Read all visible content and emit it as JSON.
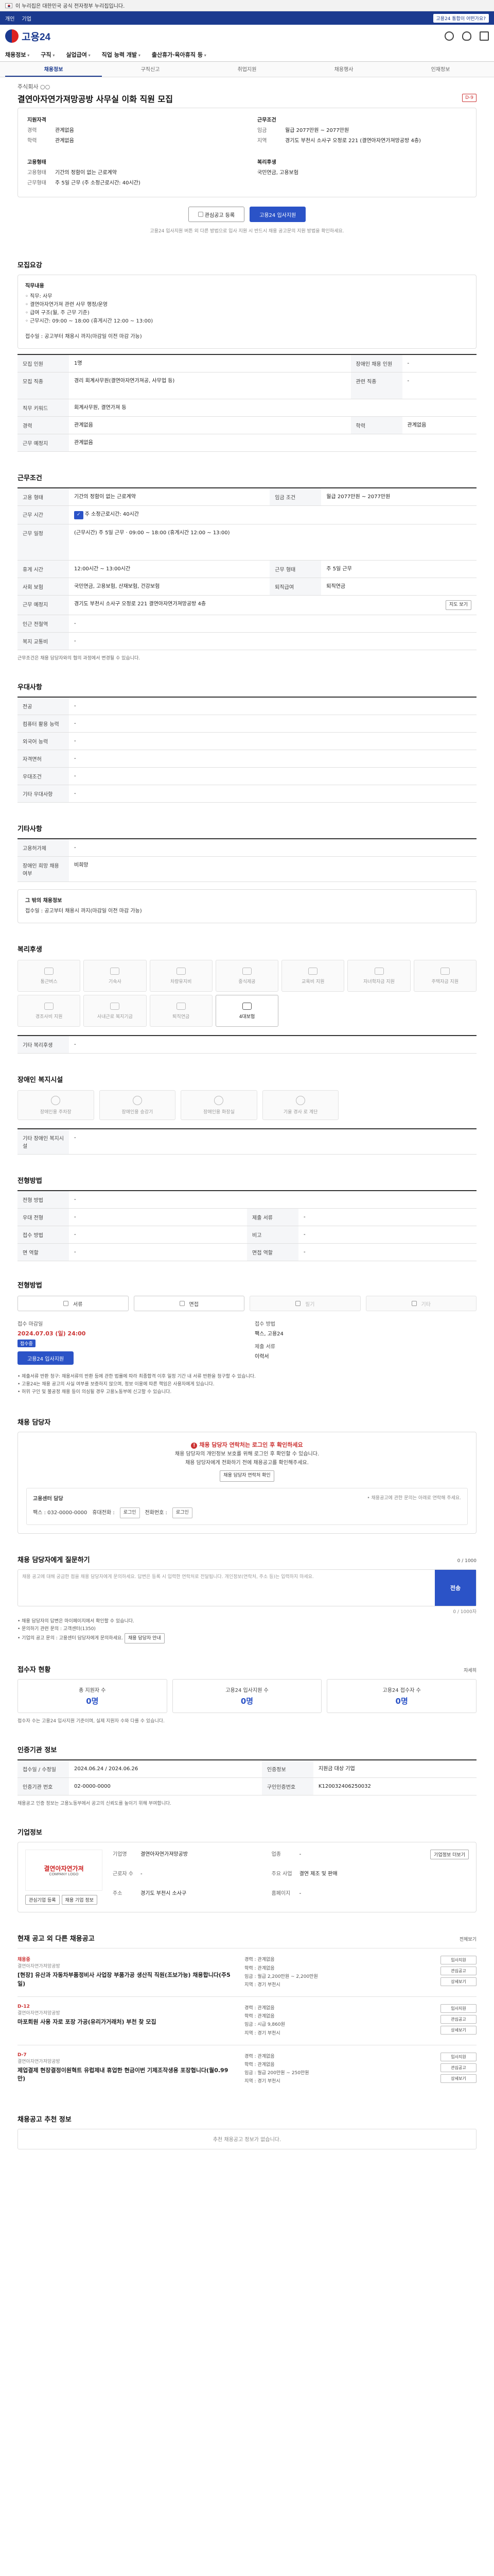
{
  "gov_banner": {
    "text": "이 누리집은 대한민국 공식 전자정부 누리집입니다."
  },
  "utilbar": {
    "left": [
      "개인",
      "기업"
    ],
    "right_badge": "고용24 통합이 어떤가요?"
  },
  "logo": {
    "text": "고용24"
  },
  "gnb": [
    "채용정보",
    "구직",
    "실업급여",
    "직업 능력 개발",
    "출산휴가·육아휴직 등"
  ],
  "subnav": [
    {
      "label": "채용정보",
      "active": true
    },
    {
      "label": "구직신고",
      "active": false
    },
    {
      "label": "취업지원",
      "active": false
    },
    {
      "label": "채용행사",
      "active": false
    },
    {
      "label": "인재정보",
      "active": false
    }
  ],
  "job": {
    "company": "주식회사 ○○",
    "title": "결연아자연가져망공방 사무실 이화 직원 모집",
    "dday": "D-9",
    "summary": {
      "qual_title": "지원자격",
      "qual": [
        {
          "k": "경력",
          "v": "관계없음"
        },
        {
          "k": "학력",
          "v": "관계없음"
        }
      ],
      "cond_title": "근무조건",
      "cond": [
        {
          "k": "임금",
          "v": "월급 2077만원 ~ 2077만원"
        },
        {
          "k": "지역",
          "v": "경기도 부천시 소사구 오정로 221 (결연아자연가져망공방 4층)"
        }
      ],
      "type_title": "고용형태",
      "type": [
        {
          "k": "고용형태",
          "v": "기간의 정함이 없는 근로계약"
        },
        {
          "k": "근무형태",
          "v": "주 5일 근무 (주 소정근로시간: 40시간)"
        }
      ],
      "welfare_title": "복리후생",
      "welfare": [
        {
          "k": "",
          "v": "국민연금, 고용보험"
        }
      ]
    },
    "buttons": {
      "scrap": "관심공고 등록",
      "apply": "고용24 입사지원"
    },
    "notice": "고용24 입사지원 버튼 외 다른 방법으로 입사 지원 시 반드시 채용 공고문의 지원 방법을 확인하세요."
  },
  "sections": {
    "recruit": "모집요강",
    "conditions": "근무조건",
    "prefer": "우대사항",
    "etc": "기타사항",
    "welfare": "복리후생",
    "barrier": "장애인 복지시설",
    "screen": "전형방법",
    "contact": "채용 담당자",
    "qna": "채용 담당자에게 질문하기",
    "status": "접수자 현황",
    "regist": "인증기관 정보",
    "company": "기업정보",
    "other_jobs": "현재 공고 외 다른 채용공고",
    "similar": "채용공고 추천 정보"
  },
  "recruit": {
    "job_label": "직무내용",
    "job_lines": [
      "◦ 직무: 사무",
      "◦ 결연아자연가져 관련 사무 행정/운영",
      "◦ 급여 구조(월, 주 근무 기준)",
      "◦ 근무시간: 09:00 ~ 18:00 (휴게시간 12:00 ~ 13:00)"
    ],
    "extra": "접수일 : 공고부터 채용시 까지(마감일 이전 마감 가능)",
    "rows": [
      {
        "k": "모집 인원",
        "v": "1명",
        "k2": "장애인 채용 인원",
        "v2": "-"
      },
      {
        "k": "모집 직종",
        "v": "경리 회계사무원(결연아자연가져공, 사무업 등)",
        "k2": "관련 직종",
        "v2": "-"
      },
      {
        "k": "직무 키워드",
        "v": "회계사무원, 결연가져 등",
        "k2": "",
        "v2": ""
      },
      {
        "k": "경력",
        "v": "관계없음",
        "k2": "학력",
        "v2": "관계없음"
      },
      {
        "k": "근무 예정지",
        "v": "관계없음",
        "k2": "",
        "v2": ""
      }
    ]
  },
  "conditions": {
    "rows": [
      {
        "k": "고용 형태",
        "v": "기간의 정함이 없는 근로계약",
        "k2": "임금 조건",
        "v2": "월급 2077만원 ~ 2077만원"
      },
      {
        "k": "근무 시간",
        "v": "주 소정근로시간: 40시간",
        "k2": "",
        "v2": ""
      },
      {
        "k": "근무 일정",
        "v": "(근무시간) 주 5일 근무 · 09:00 ~ 18:00 (휴게시간 12:00 ~ 13:00)",
        "k2": "",
        "v2": ""
      },
      {
        "k": "휴게 시간",
        "v": "12:00시간 ~ 13:00시간",
        "k2": "근무 형태",
        "v2": "주 5일 근무"
      },
      {
        "k": "사회 보험",
        "v": "국민연금, 고용보험, 산재보험, 건강보험",
        "k2": "퇴직급여",
        "v2": "퇴직연금"
      },
      {
        "k": "근무 예정지",
        "v": "경기도 부천시 소사구 오정로 221 결연아자연가져망공방 4층",
        "k2": "",
        "v2": ""
      },
      {
        "k": "인근 전철역",
        "v": "-",
        "k2": "",
        "v2": ""
      },
      {
        "k": "복지 교통비",
        "v": "-",
        "k2": "",
        "v2": ""
      }
    ],
    "map_btn": "지도 보기",
    "note": "근무조건은 채용 담당자와의 협의 과정에서 변경될 수 있습니다."
  },
  "prefer": {
    "rows": [
      {
        "k": "전공",
        "v": "-"
      },
      {
        "k": "컴퓨터 활용 능력",
        "v": "-"
      },
      {
        "k": "외국어 능력",
        "v": "-"
      },
      {
        "k": "자격면허",
        "v": "-"
      },
      {
        "k": "우대조건",
        "v": "-"
      },
      {
        "k": "기타 우대사항",
        "v": "-"
      }
    ]
  },
  "etc": {
    "rows": [
      {
        "k": "고용허가제",
        "v": "-"
      },
      {
        "k": "장애인 희망 채용 여부",
        "v": "비희망"
      }
    ],
    "box_label": "그 밖의 채용정보",
    "box_text": "접수일 : 공고부터 채용시 까지(마감일 이전 마감 가능)"
  },
  "welfare": {
    "items": [
      {
        "label": "통근버스",
        "on": false
      },
      {
        "label": "기숙사",
        "on": false
      },
      {
        "label": "차량유지비",
        "on": false
      },
      {
        "label": "중식제공",
        "on": false
      },
      {
        "label": "교육비 지원",
        "on": false
      },
      {
        "label": "자녀학자금 지원",
        "on": false
      },
      {
        "label": "주택자금 지원",
        "on": false
      },
      {
        "label": "경조사비 지원",
        "on": false
      },
      {
        "label": "사내근로 복지기금",
        "on": false
      },
      {
        "label": "퇴직연금",
        "on": false
      },
      {
        "label": "4대보험",
        "on": true
      }
    ],
    "extra_label": "기타 복리후생",
    "extra_value": "-"
  },
  "barrier": {
    "items": [
      "장애인용 주차장",
      "장애인용 승강기",
      "장애인용 화장실",
      "기울 경사 로 계단"
    ],
    "extra_label": "기타 장애인 복지시설",
    "extra_value": "-"
  },
  "screen": {
    "rows": [
      {
        "k": "전형 방법",
        "v": "-",
        "k2": "",
        "v2": ""
      },
      {
        "k": "우대 전형",
        "v": "-",
        "k2": "제출 서류",
        "v2": "-"
      },
      {
        "k": "접수 방법",
        "v": "-",
        "k2": "비고",
        "v2": "-"
      },
      {
        "k": "면 역할",
        "v": "-",
        "k2": "면접 역할",
        "v2": "-"
      }
    ],
    "steps": [
      {
        "label": "서류",
        "on": true
      },
      {
        "label": "면접",
        "on": true
      },
      {
        "label": "필기",
        "on": false
      },
      {
        "label": "기타",
        "on": false
      }
    ],
    "apply_label": "접수 마감일",
    "apply_date": "2024.07.03 (일) 24:00",
    "apply_badge": "접수중",
    "apply_btn": "고용24 입사지원",
    "method_label": "접수 방법",
    "method_value": "팩스, 고용24",
    "doc_label": "제출 서류",
    "doc_value": "이력서",
    "warnings": [
      "제출서류 반환 청구: 채용서류의 반환 등에 관한 법률에 따라 최종합격 이후 일정 기간 내 서류 반환을 청구할 수 있습니다.",
      "고용24는 채용 공고의 사실 여부를 보증하지 않으며, 정보 이용에 따른 책임은 사용자에게 있습니다.",
      "허위 구인 및 불공정 채용 등이 의심될 경우 고용노동부에 신고할 수 있습니다."
    ]
  },
  "contact": {
    "alert": "채용 담당자 연락처는 로그인 후 확인하세요",
    "line1": "채용 담당자의 개인정보 보호를 위해 로그인 후 확인할 수 있습니다.",
    "line2": "채용 담당자에게 전화하기 전에 채용공고를 확인해주세요.",
    "login_btn": "채용 담당자 연락처 확인",
    "box_title": "고용센터 담당",
    "box_note": "• 채용공고에 관한 문의는 아래로 연락해 주세요.",
    "fax_label": "팩스 : 032-0000-0000",
    "mobile_label": "휴대전화 :",
    "mobile_value": "로그인",
    "phone_label": "전화번호 :",
    "phone_value": "로그인"
  },
  "qna": {
    "counter": "0 / 1000",
    "placeholder": "채용 공고에 대해 궁금한 점을 채용 담당자에게 문의하세요. 답변은 등록 시 입력한 연락처로 전달됩니다. 개인정보(연락처, 주소 등)는 입력하지 마세요.",
    "send": "전송",
    "length": "0 / 1000자",
    "notes": [
      "채용 담당자의 답변은 마이페이지에서 확인할 수 있습니다.",
      "문의하기 관련 문의 : 고객센터(1350)",
      "기업의 공고 문의 : 고용센터 담당자에게 문의하세요."
    ],
    "inline_btn": "채용 담당자 안내"
  },
  "status": {
    "right": "자세히",
    "cards": [
      {
        "t": "총 지원자 수",
        "n": "0명"
      },
      {
        "t": "고용24 입사지원 수",
        "n": "0명"
      },
      {
        "t": "고용24 접수자 수",
        "n": "0명"
      }
    ],
    "note": "접수자 수는 고용24 입사지원 기준이며, 실제 지원자 수와 다를 수 있습니다."
  },
  "regist": {
    "rows": [
      {
        "k": "접수일 / 수정일",
        "v": "2024.06.24 / 2024.06.26",
        "k2": "인증정보",
        "v2": "지원금 대상 기업"
      },
      {
        "k": "인증기관 번호",
        "v": "02-0000-0000",
        "k2": "구인인증번호",
        "v2": "K120032406250032"
      }
    ],
    "note": "채용공고 인증 정보는 고용노동부에서 공고의 신뢰도를 높이기 위해 부여합니다."
  },
  "company": {
    "logo_main": "결연아자연가져",
    "logo_sub": "COMPANY LOGO",
    "rows": [
      {
        "k": "기업명",
        "v": "결연아자연가져망공방"
      },
      {
        "k": "업종",
        "v": "-"
      },
      {
        "k": "근로자 수",
        "v": "-"
      },
      {
        "k": "주요 사업",
        "v": "결연 제조 및 판매"
      },
      {
        "k": "주소",
        "v": "경기도 부천시 소사구"
      },
      {
        "k": "홈페이지",
        "v": "-"
      }
    ],
    "btn_more": "기업정보 더보기",
    "btns": [
      "관심기업 등록",
      "채용 기업 정보"
    ]
  },
  "other_jobs": {
    "right": "전체보기",
    "items": [
      {
        "tag": "채용중",
        "cname": "결연아자연가져망공방",
        "title": "[현장] 유산과 자동차부품정비사 사업장 부품가공 생산직 직원(조보가능) 채용합니다(주5일)",
        "info": [
          "경력 : 관계없음",
          "학력 : 관계없음",
          "임금 : 월급 2,200만원 ~ 2,200만원",
          "지역 : 경기 부천시"
        ],
        "pills": [
          "입사지원",
          "관심공고",
          "상세보기"
        ]
      },
      {
        "tag": "D-12",
        "cname": "결연아자연가져망공방",
        "title": "마포회원 사용 자로 포장 가공(유리가거래처) 부천 찾 모집",
        "info": [
          "경력 : 관계없음",
          "학력 : 관계없음",
          "임금 : 시급 9,860원",
          "지역 : 경기 부천시"
        ],
        "pills": [
          "입사지원",
          "관심공고",
          "상세보기"
        ]
      },
      {
        "tag": "D-7",
        "cname": "결연아자연가져망공방",
        "title": "제업결제 현장결정이원혁트 유럽제내 휴업한 현금이번 기제조작생용 포장협니다(월0.99만)",
        "info": [
          "경력 : 관계없음",
          "학력 : 관계없음",
          "임금 : 월급 200만원 ~ 250만원",
          "지역 : 경기 부천시"
        ],
        "pills": [
          "입사지원",
          "관심공고",
          "상세보기"
        ]
      }
    ]
  },
  "similar": {
    "empty": "추천 채용공고 정보가 없습니다."
  }
}
